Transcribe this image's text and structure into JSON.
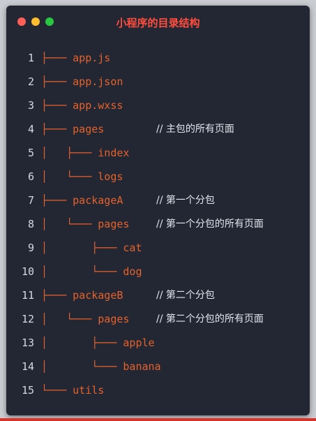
{
  "window": {
    "title": "小程序的目录结构",
    "dot_colors": [
      "#ff5f57",
      "#febc2e",
      "#28c840"
    ]
  },
  "lines": [
    {
      "number": "1",
      "prefix": "├───",
      "name": "app.js",
      "comment": ""
    },
    {
      "number": "2",
      "prefix": "├───",
      "name": "app.json",
      "comment": ""
    },
    {
      "number": "3",
      "prefix": "├───",
      "name": "app.wxss",
      "comment": ""
    },
    {
      "number": "4",
      "prefix": "├───",
      "name": "pages",
      "comment": "// 主包的所有页面"
    },
    {
      "number": "5",
      "prefix": "│   ├───",
      "name": "index",
      "comment": ""
    },
    {
      "number": "6",
      "prefix": "│   └───",
      "name": "logs",
      "comment": ""
    },
    {
      "number": "7",
      "prefix": "├───",
      "name": "packageA",
      "comment": "// 第一个分包"
    },
    {
      "number": "8",
      "prefix": "│   └───",
      "name": "pages",
      "comment": "// 第一个分包的所有页面"
    },
    {
      "number": "9",
      "prefix": "│       ├───",
      "name": "cat",
      "comment": ""
    },
    {
      "number": "10",
      "prefix": "│       └───",
      "name": "dog",
      "comment": ""
    },
    {
      "number": "11",
      "prefix": "├───",
      "name": "packageB",
      "comment": "// 第二个分包"
    },
    {
      "number": "12",
      "prefix": "│   └───",
      "name": "pages",
      "comment": "// 第二个分包的所有页面"
    },
    {
      "number": "13",
      "prefix": "│       ├───",
      "name": "apple",
      "comment": ""
    },
    {
      "number": "14",
      "prefix": "│       └───",
      "name": "banana",
      "comment": ""
    },
    {
      "number": "15",
      "prefix": "└───",
      "name": "utils",
      "comment": ""
    }
  ]
}
